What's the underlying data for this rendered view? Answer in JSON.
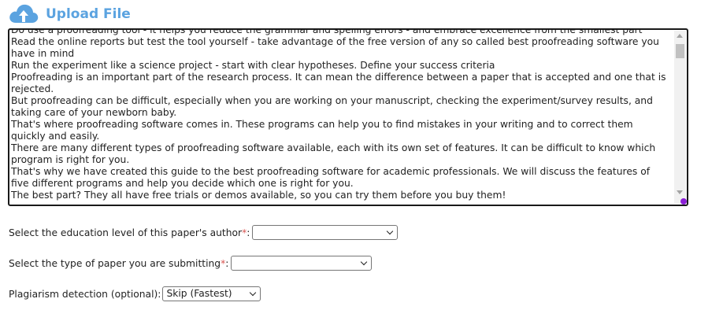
{
  "header": {
    "title": "Upload File",
    "icon": "cloud-upload-icon",
    "icon_color": "#5ba3e0"
  },
  "textarea": {
    "lines": [
      "Do use a proofreading tool - it helps you reduce the grammar and spelling errors - and embrace excellence from the smallest part",
      "Read the online reports but test the tool yourself - take advantage of the free version of any so called best proofreading software you have in mind",
      "Run the experiment like a science project - start with clear hypotheses. Define your success criteria",
      "Proofreading is an important part of the research process. It can mean the difference between a paper that is accepted and one that is rejected.",
      "But proofreading can be difficult, especially when you are working on your manuscript, checking the experiment/survey results, and taking care of your newborn baby.",
      "That's where proofreading software comes in. These programs can help you to find mistakes in your writing and to correct them quickly and easily.",
      "There are many different types of proofreading software available, each with its own set of features. It can be difficult to know which program is right for you.",
      "That's why we have created this guide to the best proofreading software for academic professionals. We will discuss the features of five different programs and help you decide which one is right for you.",
      "The best part? They all have free trials or demos available, so you can try them before you buy them!"
    ]
  },
  "form": {
    "education_label": "Select the education level of this paper's author",
    "education_value": "",
    "paper_type_label": "Select the type of paper you are submitting",
    "paper_type_value": "",
    "plagiarism_label": "Plagiarism detection (optional):",
    "plagiarism_value": "Skip (Fastest)",
    "required_mark": "*",
    "colon": ":"
  },
  "colors": {
    "accent": "#5ba3e0",
    "required": "#d9534f",
    "resize_handle": "#8b1fd6"
  }
}
